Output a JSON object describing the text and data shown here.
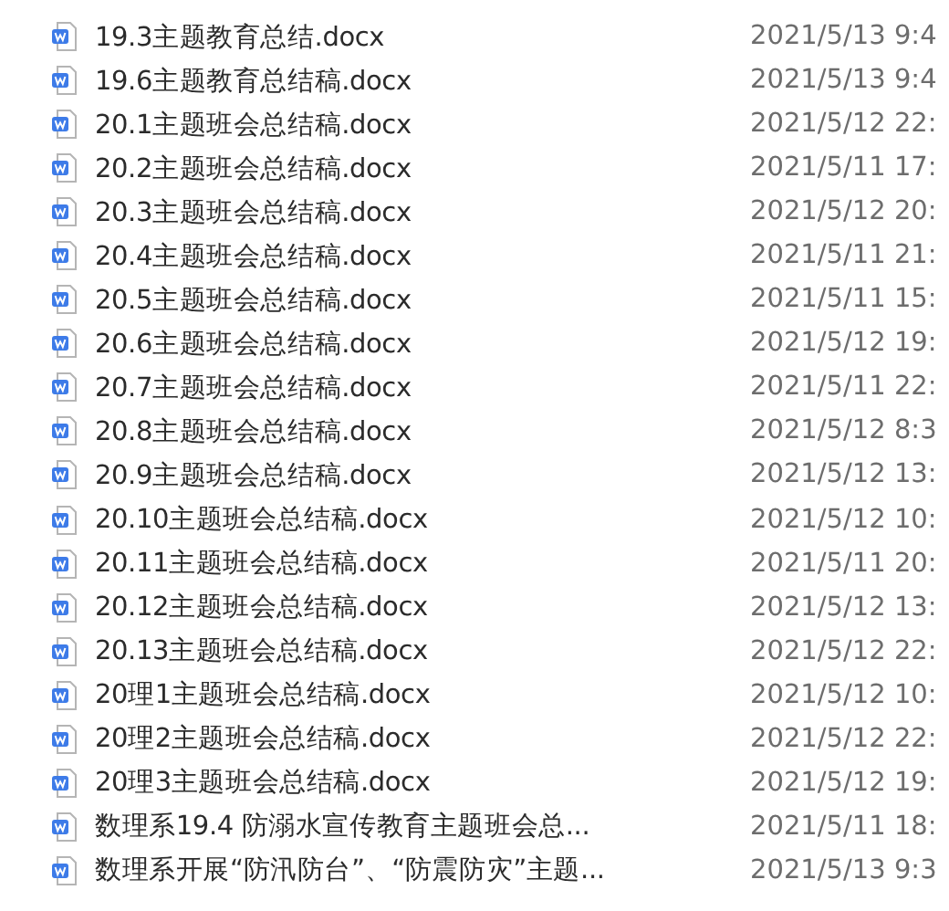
{
  "files": [
    {
      "name": "19.3主题教育总结.docx",
      "modified": "2021/5/13 9:4"
    },
    {
      "name": "19.6主题教育总结稿.docx",
      "modified": "2021/5/13 9:4"
    },
    {
      "name": "20.1主题班会总结稿.docx",
      "modified": "2021/5/12 22:"
    },
    {
      "name": "20.2主题班会总结稿.docx",
      "modified": "2021/5/11 17:"
    },
    {
      "name": "20.3主题班会总结稿.docx",
      "modified": "2021/5/12 20:"
    },
    {
      "name": "20.4主题班会总结稿.docx",
      "modified": "2021/5/11 21:"
    },
    {
      "name": "20.5主题班会总结稿.docx",
      "modified": "2021/5/11 15:"
    },
    {
      "name": "20.6主题班会总结稿.docx",
      "modified": "2021/5/12 19:"
    },
    {
      "name": "20.7主题班会总结稿.docx",
      "modified": "2021/5/11 22:"
    },
    {
      "name": "20.8主题班会总结稿.docx",
      "modified": "2021/5/12 8:3"
    },
    {
      "name": "20.9主题班会总结稿.docx",
      "modified": "2021/5/12 13:"
    },
    {
      "name": "20.10主题班会总结稿.docx",
      "modified": "2021/5/12 10:"
    },
    {
      "name": "20.11主题班会总结稿.docx",
      "modified": "2021/5/11 20:"
    },
    {
      "name": "20.12主题班会总结稿.docx",
      "modified": "2021/5/12 13:"
    },
    {
      "name": "20.13主题班会总结稿.docx",
      "modified": "2021/5/12 22:"
    },
    {
      "name": "20理1主题班会总结稿.docx",
      "modified": "2021/5/12 10:"
    },
    {
      "name": "20理2主题班会总结稿.docx",
      "modified": "2021/5/12 22:"
    },
    {
      "name": "20理3主题班会总结稿.docx",
      "modified": "2021/5/12 19:"
    },
    {
      "name": "数理系19.4 防溺水宣传教育主题班会总...",
      "modified": "2021/5/11 18:"
    },
    {
      "name": "数理系开展“防汛防台”、“防震防灾”主题...",
      "modified": "2021/5/13 9:3"
    }
  ]
}
